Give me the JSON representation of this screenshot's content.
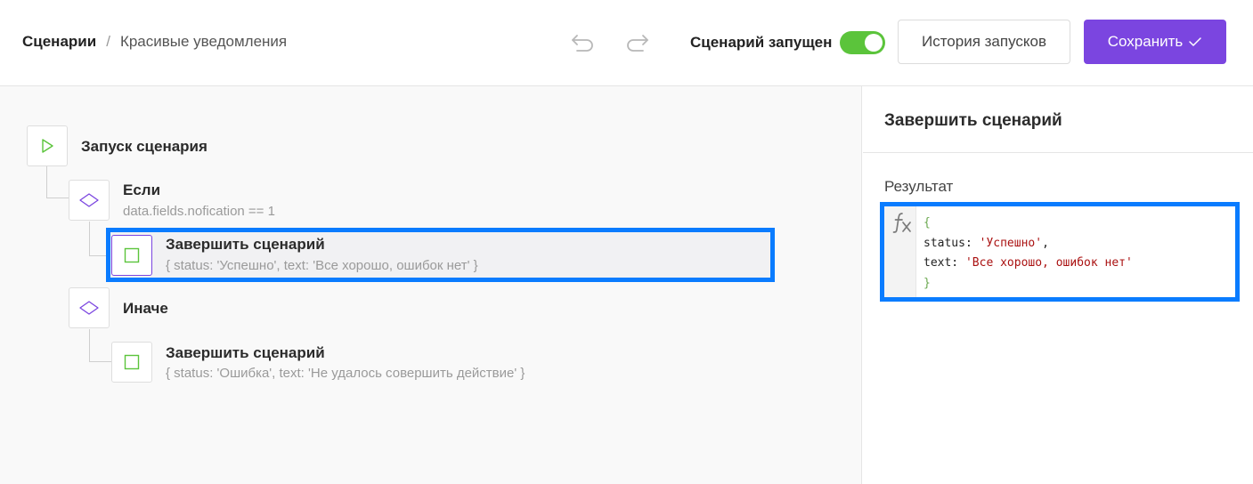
{
  "header": {
    "breadcrumb_root": "Сценарии",
    "breadcrumb_separator": "/",
    "breadcrumb_current": "Красивые уведомления",
    "undo_icon": "undo-arrow-icon",
    "redo_icon": "redo-arrow-icon",
    "run_status_label": "Сценарий запущен",
    "run_toggle_on": true,
    "history_button": "История запусков",
    "save_button": "Сохранить",
    "save_icon": "checkmark-icon"
  },
  "flow": {
    "start": {
      "icon": "play-triangle-icon",
      "title": "Запуск сценария"
    },
    "if_node": {
      "icon": "diamond-icon",
      "title": "Если",
      "condition": "data.fields.nofication == 1"
    },
    "if_end": {
      "icon": "square-icon",
      "title": "Завершить сценарий",
      "detail": "{ status: 'Успешно', text: 'Все хорошо, ошибок нет' }",
      "selected": true
    },
    "else_node": {
      "icon": "diamond-icon",
      "title": "Иначе"
    },
    "else_end": {
      "icon": "square-icon",
      "title": "Завершить сценарий",
      "detail": "{ status: 'Ошибка', text: 'Не удалось совершить действие' }"
    }
  },
  "panel": {
    "title": "Завершить сценарий",
    "result_label": "Результат",
    "fx_icon": "function-fx-icon",
    "code": {
      "open_brace": "{",
      "line1_key": "status: ",
      "line1_value": "'Успешно'",
      "line1_comma": ",",
      "line2_key": "text: ",
      "line2_value": "'Все хорошо, ошибок нет'",
      "close_brace": "}"
    }
  },
  "colors": {
    "accent": "#7b45e0",
    "toggle_on": "#5bc43b",
    "selection": "#0a7cff",
    "start_icon": "#5bc43b",
    "diamond_icon": "#7b45e0",
    "end_icon": "#5bc43b"
  }
}
